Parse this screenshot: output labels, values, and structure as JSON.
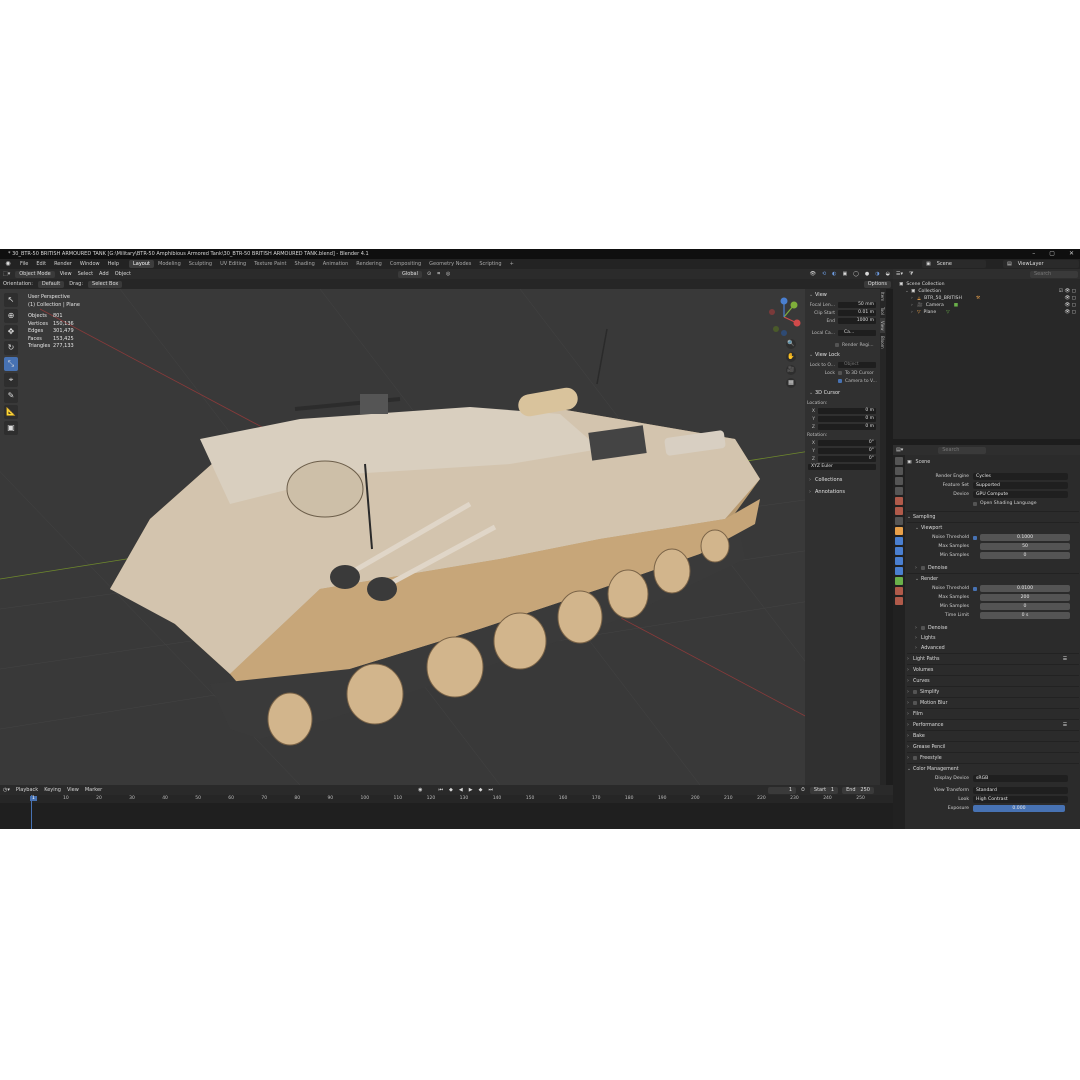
{
  "window": {
    "title": "* 30_BTR-50 BRITISH ARMOURED TANK [G:\\Military\\BTR-50 Amphibious Armored Tank\\30_BTR-50 BRITISH ARMOURED TANK.blend] - Blender 4.1"
  },
  "menu": [
    "File",
    "Edit",
    "Render",
    "Window",
    "Help"
  ],
  "workspaces": [
    "Layout",
    "Modeling",
    "Sculpting",
    "UV Editing",
    "Texture Paint",
    "Shading",
    "Animation",
    "Rendering",
    "Compositing",
    "Geometry Nodes",
    "Scripting"
  ],
  "active_workspace": "Layout",
  "scene": {
    "name": "Scene",
    "view_layer": "ViewLayer"
  },
  "header": {
    "mode": "Object Mode",
    "items": [
      "View",
      "Select",
      "Add",
      "Object"
    ],
    "transform": "Global",
    "options": "Options"
  },
  "toolheader": {
    "orientation_label": "Orientation:",
    "orientation": "Default",
    "drag_label": "Drag:",
    "drag": "Select Box"
  },
  "stats": {
    "view": "User Perspective",
    "collection": "(1) Collection | Plane",
    "rows": [
      {
        "k": "Objects",
        "v": "801"
      },
      {
        "k": "Vertices",
        "v": "150,136"
      },
      {
        "k": "Edges",
        "v": "301,479"
      },
      {
        "k": "Faces",
        "v": "153,425"
      },
      {
        "k": "Triangles",
        "v": "277,133"
      }
    ]
  },
  "npanel": {
    "view_title": "View",
    "focal_label": "Focal Len...",
    "focal": "50 mm",
    "clip_start_label": "Clip Start",
    "clip_start": "0.01 m",
    "clip_end_label": "End",
    "clip_end": "1000 m",
    "local_label": "Local Ca...",
    "local_val": "Ca...",
    "render_region": "Render Regi...",
    "view_lock_title": "View Lock",
    "lock_obj_label": "Lock to O...",
    "lock_obj_placeholder": "Object",
    "lock_label": "Lock",
    "to_cursor": "To 3D Cursor",
    "camera_to_view": "Camera to V...",
    "cursor_title": "3D Cursor",
    "location_label": "Location:",
    "loc": [
      {
        "a": "X",
        "v": "0 m"
      },
      {
        "a": "Y",
        "v": "0 m"
      },
      {
        "a": "Z",
        "v": "0 m"
      }
    ],
    "rotation_label": "Rotation:",
    "rot": [
      {
        "a": "X",
        "v": "0°"
      },
      {
        "a": "Y",
        "v": "0°"
      },
      {
        "a": "Z",
        "v": "0°"
      }
    ],
    "euler": "XYZ Euler",
    "collections": "Collections",
    "annotations": "Annotations",
    "tabs": [
      "Item",
      "Tool",
      "View",
      "Bloom"
    ]
  },
  "timeline": {
    "items": [
      "Playback",
      "Keying",
      "View",
      "Marker"
    ],
    "current": "1",
    "start_label": "Start",
    "start": "1",
    "end_label": "End",
    "end": "250",
    "ticks": [
      "1",
      "10",
      "20",
      "30",
      "40",
      "50",
      "60",
      "70",
      "80",
      "90",
      "100",
      "110",
      "120",
      "130",
      "140",
      "150",
      "160",
      "170",
      "180",
      "190",
      "200",
      "210",
      "220",
      "230",
      "240",
      "250"
    ]
  },
  "outliner": {
    "search_placeholder": "Search",
    "rows": [
      "Scene Collection",
      "Collection",
      "BTR_50_BRITISH",
      "Camera",
      "Plane"
    ]
  },
  "properties": {
    "search_placeholder": "Search",
    "context": "Scene",
    "render_engine_label": "Render Engine",
    "render_engine": "Cycles",
    "feature_set_label": "Feature Set",
    "feature_set": "Supported",
    "device_label": "Device",
    "device": "GPU Compute",
    "osl": "Open Shading Language",
    "sampling": "Sampling",
    "viewport": "Viewport",
    "noise_threshold_label": "Noise Threshold",
    "vp_noise": "0.1000",
    "max_samples_label": "Max Samples",
    "vp_max": "50",
    "min_samples_label": "Min Samples",
    "vp_min": "0",
    "denoise": "Denoise",
    "render": "Render",
    "r_noise": "0.0100",
    "r_max": "200",
    "r_min": "0",
    "time_limit_label": "Time Limit",
    "time_limit": "0 s",
    "lights": "Lights",
    "advanced": "Advanced",
    "sections": [
      "Light Paths",
      "Volumes",
      "Curves",
      "Simplify",
      "Motion Blur",
      "Film",
      "Performance",
      "Bake",
      "Grease Pencil",
      "Freestyle",
      "Color Management"
    ],
    "display_device_label": "Display Device",
    "display_device": "sRGB",
    "view_transform_label": "View Transform",
    "view_transform": "Standard",
    "look_label": "Look",
    "look": "High Contrast",
    "exposure_label": "Exposure",
    "exposure": "0.000"
  },
  "colors": {
    "accent": "#4772b3",
    "tank": "#c9a777",
    "grid_x": "#8a3a3a",
    "grid_y": "#6f8a2c"
  }
}
